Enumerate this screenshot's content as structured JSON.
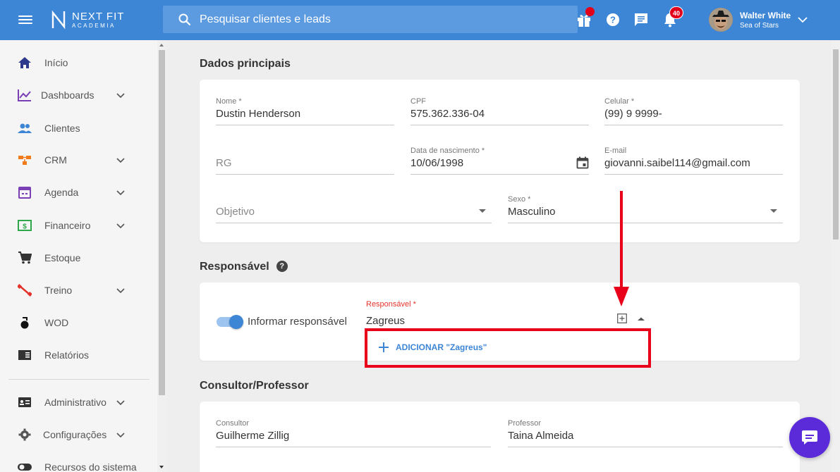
{
  "topbar": {
    "logo_line1": "NEXT FIT",
    "logo_line2": "ACADEMIA",
    "search_placeholder": "Pesquisar clientes e leads",
    "notifications_count": "40",
    "user_name": "Walter White",
    "user_subtitle": "Sea of Stars",
    "accent_color": "#3d86d6"
  },
  "sidebar": {
    "items": [
      {
        "label": "Início",
        "icon": "home-icon"
      },
      {
        "label": "Dashboards",
        "icon": "chart-line-icon"
      },
      {
        "label": "Clientes",
        "icon": "people-icon"
      },
      {
        "label": "CRM",
        "icon": "crm-flow-icon"
      },
      {
        "label": "Agenda",
        "icon": "calendar-icon"
      },
      {
        "label": "Financeiro",
        "icon": "money-icon"
      },
      {
        "label": "Estoque",
        "icon": "cart-icon"
      },
      {
        "label": "Treino",
        "icon": "dumbbell-icon"
      },
      {
        "label": "WOD",
        "icon": "kettlebell-icon"
      },
      {
        "label": "Relatórios",
        "icon": "report-icon"
      },
      {
        "label": "Administrativo",
        "icon": "id-card-icon"
      },
      {
        "label": "Configurações",
        "icon": "gear-icon"
      },
      {
        "label": "Recursos do sistema",
        "icon": "toggle-icon"
      }
    ]
  },
  "main": {
    "section_principal": "Dados principais",
    "nome_label": "Nome *",
    "nome_value": "Dustin Henderson",
    "cpf_label": "CPF",
    "cpf_value": "575.362.336-04",
    "celular_label": "Celular *",
    "celular_value": "(99) 9 9999-",
    "rg_placeholder": "RG",
    "nascimento_label": "Data de nascimento *",
    "nascimento_value": "10/06/1998",
    "email_label": "E-mail",
    "email_value": "giovanni.saibel114@gmail.com",
    "objetivo_placeholder": "Objetivo",
    "sexo_label": "Sexo *",
    "sexo_value": "Masculino",
    "section_responsavel": "Responsável",
    "toggle_label": "Informar responsável",
    "toggle_on": true,
    "responsavel_label": "Responsável *",
    "responsavel_value": "Zagreus",
    "add_option": "ADICIONAR \"Zagreus\"",
    "section_consultor": "Consultor/Professor",
    "consultor_label": "Consultor",
    "consultor_value": "Guilherme Zillig",
    "professor_label": "Professor",
    "professor_value": "Taina Almeida"
  }
}
